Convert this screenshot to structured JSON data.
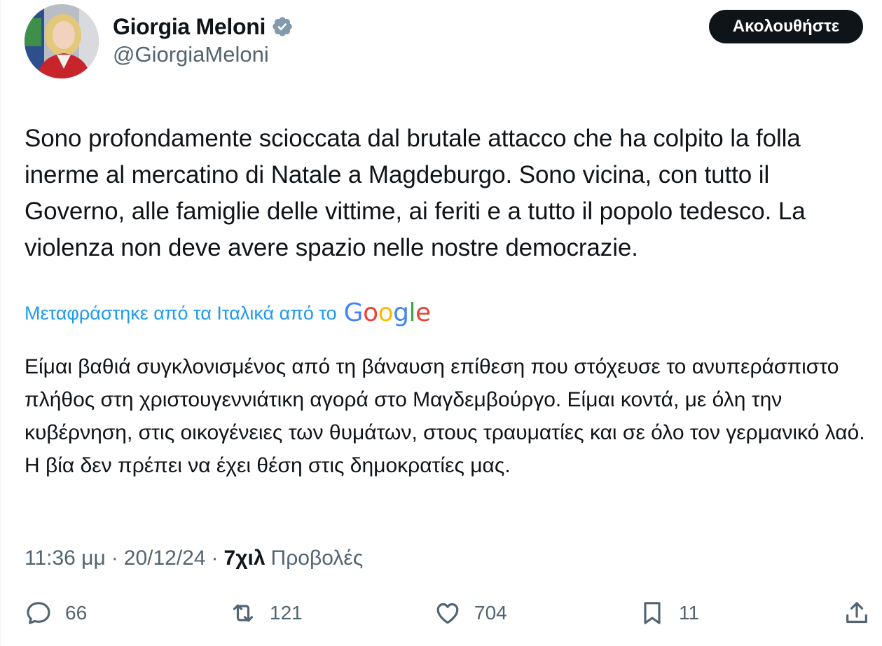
{
  "author": {
    "display_name": "Giorgia Meloni",
    "handle": "@GiorgiaMeloni",
    "verified": true
  },
  "follow_button": {
    "label": "Ακολουθήστε"
  },
  "tweet": {
    "text": "Sono profondamente scioccata dal brutale attacco che ha colpito la folla inerme al mercatino di Natale a Magdeburgo. Sono vicina, con tutto il Governo, alle famiglie delle vittime, ai feriti e a tutto il popolo tedesco. La violenza non deve avere spazio nelle nostre democrazie.",
    "translation_label": "Μεταφράστηκε από τα Ιταλικά από το",
    "translation_provider": "Google",
    "translated_text": "Είμαι βαθιά συγκλονισμένος από τη βάναυση επίθεση που στόχευσε το ανυπεράσπιστο πλήθος στη χριστουγεννιάτικη αγορά στο Μαγδεμβούργο. Είμαι κοντά, με όλη την κυβέρνηση, στις οικογένειες των θυμάτων, στους τραυματίες και σε όλο τον γερμανικό λαό. Η βία δεν πρέπει να έχει θέση στις δημοκρατίες μας."
  },
  "meta": {
    "time": "11:36 μμ",
    "separator": "·",
    "date": "20/12/24",
    "views_count": "7χιλ",
    "views_label": "Προβολές"
  },
  "actions": {
    "replies": "66",
    "reposts": "121",
    "likes": "704",
    "bookmarks": "11"
  },
  "colors": {
    "text": "#0f1419",
    "secondary": "#536471",
    "link": "#1d9bf0",
    "verified": "#829aab",
    "google_blue": "#4285f4",
    "google_red": "#ea4335",
    "google_yellow": "#fbbc05",
    "google_green": "#34a853"
  },
  "icons": {
    "verified": "verified-badge-icon",
    "reply": "speech-bubble-icon",
    "repost": "repost-arrows-icon",
    "like": "heart-icon",
    "bookmark": "bookmark-icon",
    "share": "share-upload-icon"
  }
}
